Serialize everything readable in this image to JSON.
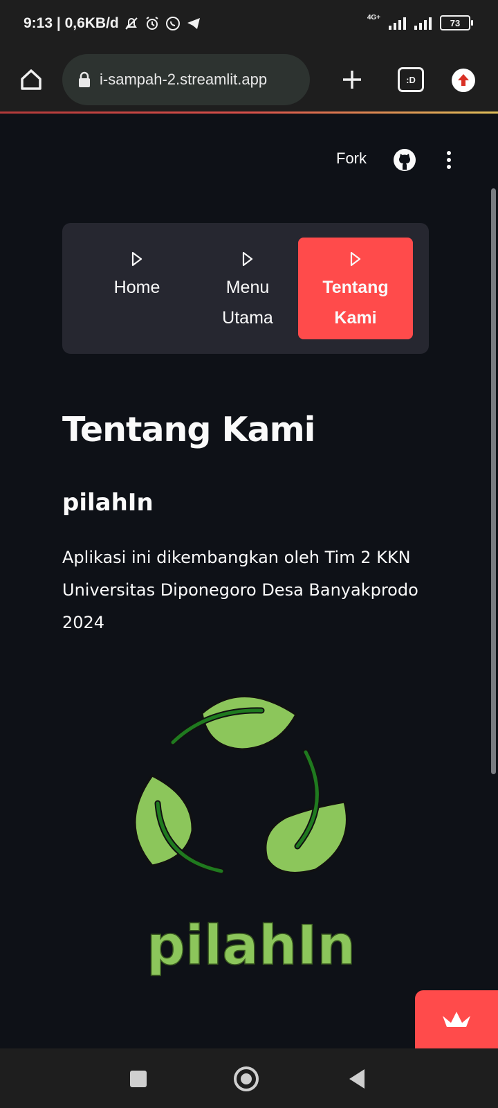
{
  "status_bar": {
    "time_and_rate": "9:13 | 0,6KB/d",
    "network": "4G+",
    "battery": "73"
  },
  "browser": {
    "url": "i-sampah-2.streamlit.app",
    "tabs_label": ":D"
  },
  "header": {
    "fork_label": "Fork"
  },
  "nav_menu": {
    "items": [
      {
        "label": "Home",
        "active": false
      },
      {
        "label": "Menu Utama",
        "active": false
      },
      {
        "label": "Tentang Kami",
        "active": true
      }
    ]
  },
  "content": {
    "title": "Tentang Kami",
    "subtitle": "pilahIn",
    "description": "Aplikasi ini dikembangkan oleh Tim 2 KKN Universitas Diponegoro Desa Banyakprodo 2024",
    "logo_text": "pilahIn"
  },
  "colors": {
    "background": "#0e1117",
    "accent": "#ff4b4b",
    "leaf": "#8cc65b",
    "stem": "#1f7a1f"
  },
  "icons": {
    "home": "home-icon",
    "lock": "lock-icon",
    "plus": "plus-icon",
    "tabs": "tabs-icon",
    "update": "update-icon",
    "github": "github-icon",
    "more": "more-vert-icon",
    "nav_item": "play-outline-icon",
    "streamlit": "streamlit-crown-icon",
    "recents": "square-icon",
    "home_nav": "circle-icon",
    "back": "back-triangle-icon"
  }
}
